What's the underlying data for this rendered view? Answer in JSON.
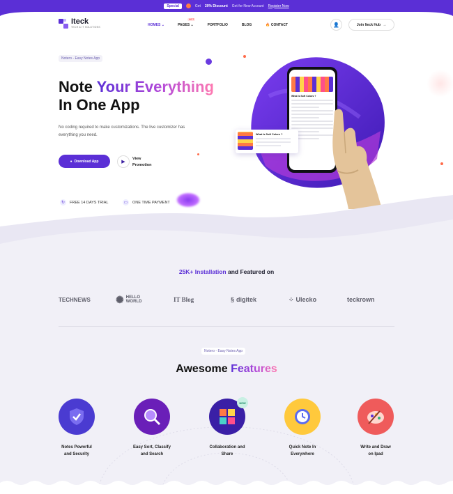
{
  "promo_bar": {
    "badge": "Special",
    "text_prefix": "Get",
    "discount": "20% Discount",
    "text_suffix": "Get for New Account",
    "link": "Register Now"
  },
  "brand": {
    "name": "Iteck",
    "tagline": "TECH & IT SOLUTIONS"
  },
  "nav": {
    "items": [
      {
        "label": "HOMES",
        "has_dropdown": true
      },
      {
        "label": "PAGES",
        "has_dropdown": true,
        "badge": "HOT"
      },
      {
        "label": "PORTFOLIO"
      },
      {
        "label": "BLOG"
      },
      {
        "label": "CONTACT"
      }
    ],
    "join_label": "Join Iteck Hub"
  },
  "hero": {
    "chip": "Notero - Easy Notes App",
    "title_plain1": "Note",
    "title_grad": "Your Everything",
    "title_line2": "In One App",
    "description": "No coding required to make customizations. The live customizer has everything you need.",
    "download_label": "Download App",
    "promo_line1": "View",
    "promo_line2": "Promotion",
    "feature1": "FREE 14 DAYS TRIAL",
    "feature2": "ONE TIME PAYMENT",
    "phone_title": "What is Soft Colors ?",
    "card_title": "What Is Soft Colors ?"
  },
  "installation": {
    "highlight": "25K+ Installation",
    "rest": "and Featured on"
  },
  "partner_logos": [
    "TECHNEWS",
    "HELLO WORLD",
    "IT Blog",
    "digitek",
    "Ulecko",
    "teckrown"
  ],
  "features_section": {
    "chip": "Notero - Easy Notes App",
    "title_plain": "Awesome",
    "title_grad": "Features",
    "items": [
      {
        "line1": "Notes Powerful",
        "line2": "and Security",
        "icon": "shield-check-icon",
        "color": "#4a3bd1"
      },
      {
        "line1": "Easy Sort, Classify",
        "line2": "and Search",
        "icon": "magnifier-icon",
        "color": "#6a1fb8"
      },
      {
        "line1": "Collaboration and",
        "line2": "Share",
        "icon": "puzzle-icon",
        "color": "#3a1fa6",
        "badge": "NEW"
      },
      {
        "line1": "Quick Note In",
        "line2": "Everywhere",
        "icon": "clock-icon",
        "color": "#ffc93c"
      },
      {
        "line1": "Write and Draw",
        "line2": "on Ipad",
        "icon": "palette-icon",
        "color": "#ef5b5b"
      }
    ]
  },
  "colors": {
    "accent": "#5b2fd6",
    "accent_pink": "#ff7ab0",
    "section_bg": "#f1f0f7"
  }
}
